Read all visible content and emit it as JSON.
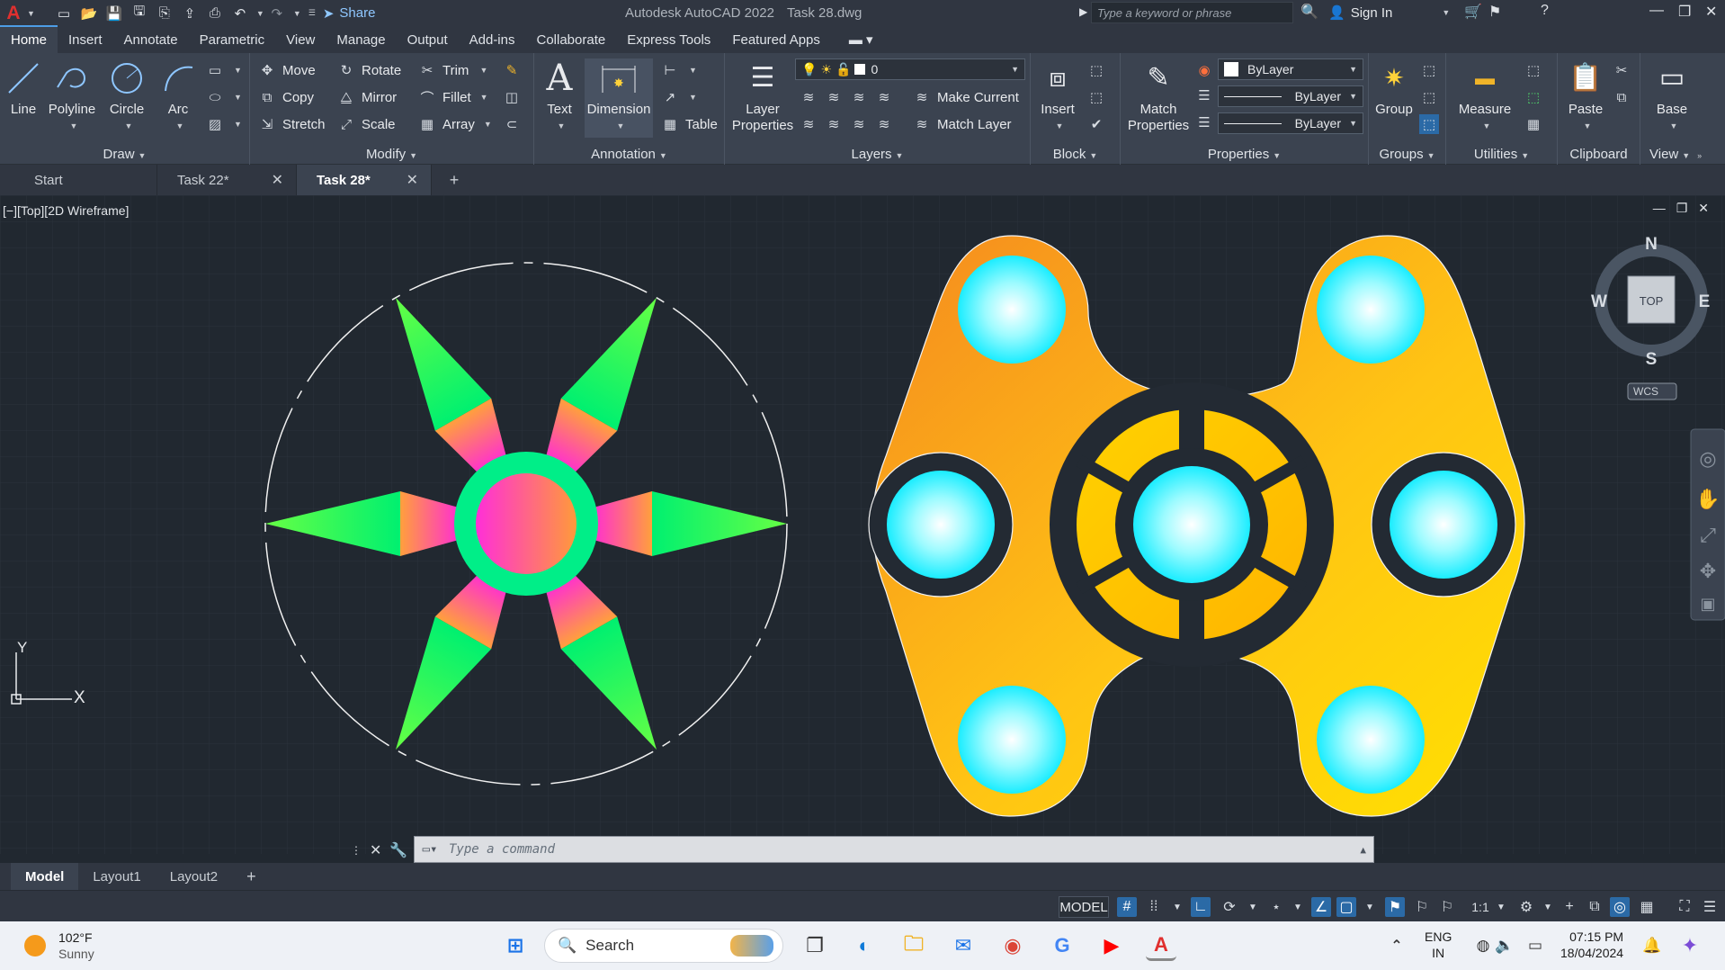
{
  "titlebar": {
    "app_title": "Autodesk AutoCAD 2022",
    "file_title": "Task 28.dwg",
    "share_label": "Share",
    "search_placeholder": "Type a keyword or phrase",
    "signin_label": "Sign In"
  },
  "ribbon_tabs": [
    "Home",
    "Insert",
    "Annotate",
    "Parametric",
    "View",
    "Manage",
    "Output",
    "Add-ins",
    "Collaborate",
    "Express Tools",
    "Featured Apps"
  ],
  "draw": {
    "title": "Draw",
    "line": "Line",
    "polyline": "Polyline",
    "circle": "Circle",
    "arc": "Arc"
  },
  "modify": {
    "title": "Modify",
    "move": "Move",
    "rotate": "Rotate",
    "trim": "Trim",
    "copy": "Copy",
    "mirror": "Mirror",
    "fillet": "Fillet",
    "stretch": "Stretch",
    "scale": "Scale",
    "array": "Array"
  },
  "annotation": {
    "title": "Annotation",
    "text": "Text",
    "dimension": "Dimension",
    "table": "Table"
  },
  "layers": {
    "title": "Layers",
    "layer_properties_1": "Layer",
    "layer_properties_2": "Properties",
    "current_layer": "0",
    "make_current": "Make Current",
    "match_layer": "Match Layer"
  },
  "block": {
    "title": "Block",
    "insert": "Insert"
  },
  "properties": {
    "title": "Properties",
    "match_1": "Match",
    "match_2": "Properties",
    "color": "ByLayer",
    "linetype": "ByLayer",
    "lineweight": "ByLayer"
  },
  "groups": {
    "title": "Groups",
    "group": "Group"
  },
  "utilities": {
    "title": "Utilities",
    "measure": "Measure"
  },
  "clipboard": {
    "title": "Clipboard",
    "paste": "Paste"
  },
  "view_panel": {
    "title": "View",
    "base": "Base"
  },
  "doc_tabs": [
    {
      "label": "Start"
    },
    {
      "label": "Task 22*"
    },
    {
      "label": "Task 28*"
    }
  ],
  "viewport": {
    "label": "[−][Top][2D Wireframe]"
  },
  "viewcube": {
    "n": "N",
    "s": "S",
    "e": "E",
    "w": "W",
    "top": "TOP",
    "wcs": "WCS"
  },
  "ucs": {
    "x": "X",
    "y": "Y"
  },
  "command": {
    "placeholder": "Type a command"
  },
  "layout_tabs": [
    "Model",
    "Layout1",
    "Layout2"
  ],
  "status": {
    "model": "MODEL",
    "scale": "1:1"
  },
  "taskbar": {
    "temp": "102°F",
    "condition": "Sunny",
    "search": "Search",
    "lang_1": "ENG",
    "lang_2": "IN",
    "time": "07:15 PM",
    "date": "18/04/2024"
  },
  "colors": {
    "accent": "#4d9de6",
    "canvas": "#212830",
    "star_green": "#00ee66",
    "star_magenta": "#ff33cc",
    "spinner_orange": "#f7a11a",
    "spinner_yellow": "#ffe000",
    "bearing_cyan": "#00f0ff"
  }
}
